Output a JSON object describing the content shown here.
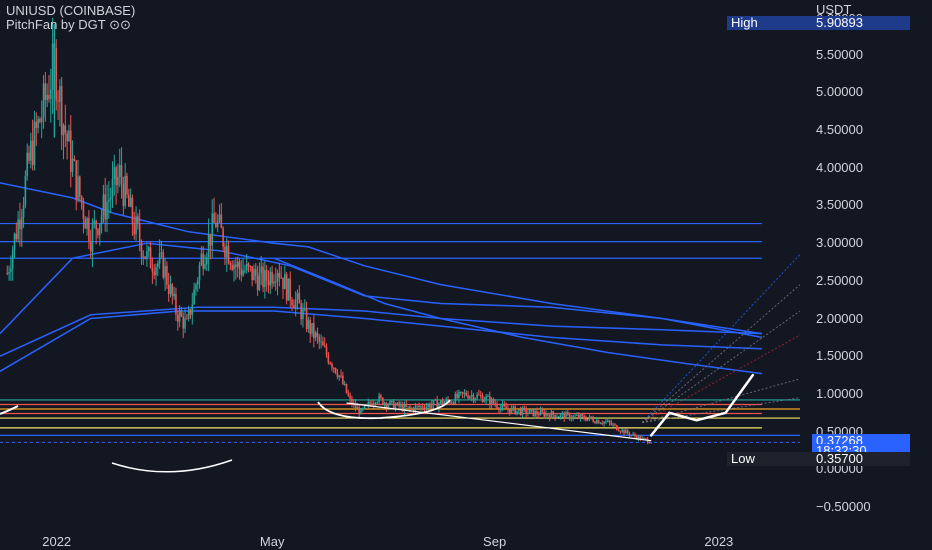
{
  "symbol": "UNIUSD (COINBASE)",
  "indicator": "PitchFan by DGT ⊙⊙",
  "currency": "USDT",
  "high_label": "High",
  "high_value": "5.90893",
  "low_label": "Low",
  "low_value": "0.35700",
  "last_price": "0.37268",
  "countdown": "18:32:30",
  "colors": {
    "up": "#26a69a",
    "down": "#ef5350",
    "ma": "#2962ff",
    "level": "#2962ff",
    "tag_blue": "#2962ff",
    "tag_dark": "#1e222d"
  },
  "chart_data": {
    "type": "candlestick",
    "title": "UNIUSD (COINBASE)",
    "ylabel": "USDT",
    "ylim": [
      -0.5,
      6.0
    ],
    "y_ticks": [
      "5.50000",
      "5.00000",
      "4.50000",
      "4.00000",
      "3.50000",
      "3.00000",
      "2.50000",
      "2.00000",
      "1.50000",
      "1.00000",
      "0.50000",
      "0.00000",
      "−0.50000"
    ],
    "x_ticks": [
      "2022",
      "May",
      "Sep",
      "2023"
    ],
    "x_tick_times": [
      "2022-01-01",
      "2022-05-01",
      "2022-09-01",
      "2023-01-01"
    ],
    "range": [
      "2021-12-01",
      "2023-02-15"
    ],
    "close_path": [
      [
        "2021-12-05",
        2.6
      ],
      [
        "2021-12-12",
        3.4
      ],
      [
        "2021-12-18",
        4.2
      ],
      [
        "2021-12-26",
        4.9
      ],
      [
        "2021-12-31",
        5.4
      ],
      [
        "2022-01-05",
        4.6
      ],
      [
        "2022-01-12",
        3.8
      ],
      [
        "2022-01-20",
        3.1
      ],
      [
        "2022-01-28",
        3.5
      ],
      [
        "2022-02-05",
        3.9
      ],
      [
        "2022-02-12",
        3.3
      ],
      [
        "2022-02-20",
        2.8
      ],
      [
        "2022-03-01",
        2.7
      ],
      [
        "2022-03-08",
        2.1
      ],
      [
        "2022-03-14",
        1.9
      ],
      [
        "2022-03-22",
        2.8
      ],
      [
        "2022-03-30",
        3.3
      ],
      [
        "2022-04-04",
        3.0
      ],
      [
        "2022-04-10",
        2.7
      ],
      [
        "2022-04-18",
        2.6
      ],
      [
        "2022-04-26",
        2.5
      ],
      [
        "2022-05-03",
        2.7
      ],
      [
        "2022-05-08",
        2.4
      ],
      [
        "2022-05-14",
        2.2
      ],
      [
        "2022-05-20",
        1.9
      ],
      [
        "2022-05-28",
        1.6
      ],
      [
        "2022-06-05",
        1.3
      ],
      [
        "2022-06-12",
        0.9
      ],
      [
        "2022-06-18",
        0.75
      ],
      [
        "2022-06-26",
        0.95
      ],
      [
        "2022-07-05",
        0.85
      ],
      [
        "2022-07-15",
        0.8
      ],
      [
        "2022-07-25",
        0.85
      ],
      [
        "2022-08-05",
        0.9
      ],
      [
        "2022-08-15",
        1.0
      ],
      [
        "2022-08-25",
        0.95
      ],
      [
        "2022-09-05",
        0.8
      ],
      [
        "2022-09-20",
        0.75
      ],
      [
        "2022-10-05",
        0.72
      ],
      [
        "2022-10-20",
        0.68
      ],
      [
        "2022-11-01",
        0.62
      ],
      [
        "2022-11-10",
        0.5
      ],
      [
        "2022-11-20",
        0.4
      ],
      [
        "2022-11-25",
        0.37268
      ]
    ],
    "moving_averages": [
      {
        "name": "MA 1",
        "points": [
          [
            "2021-12-01",
            1.8
          ],
          [
            "2022-01-10",
            2.8
          ],
          [
            "2022-02-20",
            3.0
          ],
          [
            "2022-04-01",
            2.9
          ],
          [
            "2022-05-10",
            2.7
          ],
          [
            "2022-06-20",
            2.3
          ],
          [
            "2022-08-01",
            2.2
          ],
          [
            "2022-10-01",
            2.15
          ],
          [
            "2022-12-01",
            2.0
          ],
          [
            "2023-01-25",
            1.75
          ]
        ]
      },
      {
        "name": "MA 2",
        "points": [
          [
            "2021-12-01",
            1.5
          ],
          [
            "2022-01-20",
            2.05
          ],
          [
            "2022-03-20",
            2.15
          ],
          [
            "2022-05-01",
            2.15
          ],
          [
            "2022-06-20",
            2.1
          ],
          [
            "2022-08-01",
            2.0
          ],
          [
            "2022-10-01",
            1.9
          ],
          [
            "2022-12-01",
            1.85
          ],
          [
            "2023-01-25",
            1.8
          ]
        ]
      },
      {
        "name": "MA 3",
        "points": [
          [
            "2021-12-01",
            1.3
          ],
          [
            "2022-01-20",
            2.0
          ],
          [
            "2022-03-10",
            2.1
          ],
          [
            "2022-05-01",
            2.1
          ],
          [
            "2022-06-20",
            2.0
          ],
          [
            "2022-08-01",
            1.9
          ],
          [
            "2022-10-01",
            1.75
          ],
          [
            "2022-12-01",
            1.65
          ],
          [
            "2023-01-25",
            1.6
          ]
        ]
      },
      {
        "name": "MA 4",
        "points": [
          [
            "2021-12-01",
            3.8
          ],
          [
            "2022-01-10",
            3.6
          ],
          [
            "2022-02-01",
            3.4
          ],
          [
            "2022-03-15",
            3.15
          ],
          [
            "2022-05-01",
            3.0
          ],
          [
            "2022-05-20",
            2.95
          ],
          [
            "2022-06-20",
            2.7
          ],
          [
            "2022-08-01",
            2.45
          ],
          [
            "2022-10-01",
            2.2
          ],
          [
            "2022-12-01",
            2.0
          ],
          [
            "2023-01-25",
            1.8
          ]
        ]
      },
      {
        "name": "MA 5",
        "points": [
          [
            "2022-05-01",
            2.8
          ],
          [
            "2022-06-01",
            2.5
          ],
          [
            "2022-07-01",
            2.2
          ],
          [
            "2022-08-01",
            2.0
          ],
          [
            "2022-09-15",
            1.75
          ],
          [
            "2022-11-01",
            1.55
          ],
          [
            "2022-12-15",
            1.4
          ],
          [
            "2023-01-25",
            1.27
          ]
        ]
      }
    ],
    "horizontal_levels": [
      {
        "y": 3.26,
        "color": "#2962ff",
        "from": "2021-12-01",
        "to": "2023-01-25"
      },
      {
        "y": 3.02,
        "color": "#2962ff",
        "from": "2021-12-01",
        "to": "2023-01-25"
      },
      {
        "y": 2.8,
        "color": "#2962ff",
        "from": "2021-12-01",
        "to": "2023-01-25"
      },
      {
        "y": 0.92,
        "color": "#26a69a",
        "from": "2021-12-01",
        "to": "2023-02-15"
      },
      {
        "y": 0.86,
        "color": "#ef5350",
        "from": "2021-12-01",
        "to": "2023-01-25"
      },
      {
        "y": 0.8,
        "color": "#f5a623",
        "from": "2021-12-01",
        "to": "2023-02-15"
      },
      {
        "y": 0.74,
        "color": "#ef5350",
        "from": "2021-12-01",
        "to": "2023-01-25"
      },
      {
        "y": 0.68,
        "color": "#f5e663",
        "from": "2021-12-01",
        "to": "2023-02-15"
      },
      {
        "y": 0.55,
        "color": "#f5e663",
        "from": "2021-12-01",
        "to": "2023-01-25"
      },
      {
        "y": 0.45,
        "color": "#2962ff",
        "from": "2021-12-01",
        "to": "2023-02-15"
      }
    ],
    "pitchfan_origin": [
      "2022-11-20",
      0.62
    ],
    "pitchfan_lines": [
      {
        "to": [
          "2023-02-15",
          2.85
        ],
        "color": "#2962ff"
      },
      {
        "to": [
          "2023-02-15",
          2.45
        ],
        "color": "#787b86"
      },
      {
        "to": [
          "2023-02-15",
          2.1
        ],
        "color": "#787b86"
      },
      {
        "to": [
          "2023-02-15",
          1.78
        ],
        "color": "#b22833"
      },
      {
        "to": [
          "2023-02-15",
          1.2
        ],
        "color": "#787b86"
      },
      {
        "to": [
          "2023-02-15",
          0.95
        ],
        "color": "#787b86"
      }
    ],
    "projection_path": [
      [
        "2022-11-25",
        0.45
      ],
      [
        "2022-12-05",
        0.75
      ],
      [
        "2022-12-20",
        0.65
      ],
      [
        "2023-01-05",
        0.75
      ],
      [
        "2023-01-20",
        1.25
      ]
    ],
    "trend_line": [
      [
        "2022-06-10",
        0.88
      ],
      [
        "2022-11-25",
        0.38
      ]
    ]
  }
}
